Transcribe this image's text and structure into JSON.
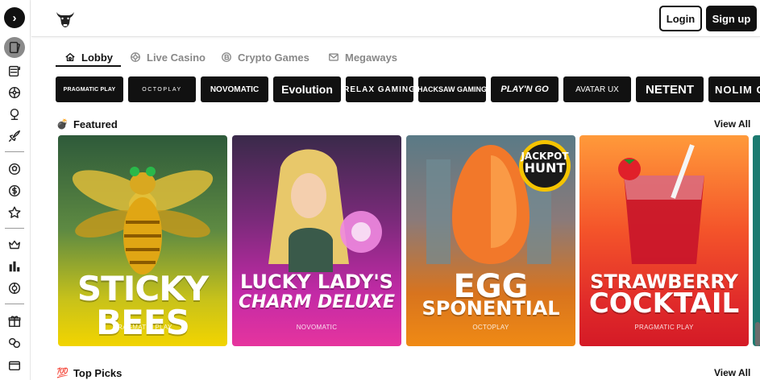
{
  "header": {
    "logo_icon": "bull-head-icon",
    "login_label": "Login",
    "signup_label": "Sign up"
  },
  "sidebar": {
    "toggle_icon": "chevron-right-icon",
    "items": [
      {
        "icon": "cards-icon",
        "active": true
      },
      {
        "icon": "slot-machine-icon"
      },
      {
        "icon": "roulette-icon"
      },
      {
        "icon": "trophy-globe-icon"
      },
      {
        "icon": "rocket-icon"
      },
      {
        "icon": "football-icon"
      },
      {
        "icon": "coin-icon"
      },
      {
        "icon": "star-icon"
      },
      {
        "icon": "crown-icon"
      },
      {
        "icon": "leaderboard-icon"
      },
      {
        "icon": "wheel-icon"
      },
      {
        "icon": "gift-icon"
      },
      {
        "icon": "coins-stack-icon"
      }
    ]
  },
  "tabs": [
    {
      "label": "Lobby",
      "icon": "home-icon",
      "active": true
    },
    {
      "label": "Live Casino",
      "icon": "chip-icon",
      "active": false
    },
    {
      "label": "Crypto Games",
      "icon": "crypto-icon",
      "active": false
    },
    {
      "label": "Megaways",
      "icon": "mail-icon",
      "active": false
    }
  ],
  "providers": [
    {
      "name": "PRAGMATIC PLAY"
    },
    {
      "name": "OCTOPLAY"
    },
    {
      "name": "NOVOMATIC"
    },
    {
      "name": "Evolution"
    },
    {
      "name": "RELAX GAMING"
    },
    {
      "name": "HACKSAW GAMING"
    },
    {
      "name": "PLAY'N GO"
    },
    {
      "name": "AVATAR UX"
    },
    {
      "name": "NETENT"
    },
    {
      "name": "NOLIM CITY"
    }
  ],
  "featured": {
    "title": "Featured",
    "emoji": "💣",
    "view_all": "View All",
    "games": [
      {
        "title_line1": "STICKY BEES",
        "title_line2": "",
        "provider": "PRAGMATIC PLAY",
        "colors": [
          "#3a6d3b",
          "#9cb54a",
          "#f0d100"
        ]
      },
      {
        "title_line1": "LUCKY LADY'S",
        "title_line2": "CHARM DELUXE",
        "provider": "NOVOMATIC",
        "colors": [
          "#5a2a6a",
          "#b62ab8",
          "#e33aa7"
        ]
      },
      {
        "title_line1": "EGG",
        "title_line2": "SPONENTIAL",
        "provider": "OCTOPLAY",
        "colors": [
          "#3d6a70",
          "#c06a3a",
          "#f08a1a"
        ],
        "badge_line1": "JACKPOT",
        "badge_line2": "HUNT"
      },
      {
        "title_line1": "STRAWBERRY",
        "title_line2": "COCKTAIL",
        "provider": "PRAGMATIC PLAY",
        "colors": [
          "#ff8a2a",
          "#ee3a2a",
          "#d81e2a"
        ]
      }
    ]
  },
  "top_picks": {
    "title": "Top Picks",
    "emoji": "💯",
    "view_all": "View All"
  }
}
